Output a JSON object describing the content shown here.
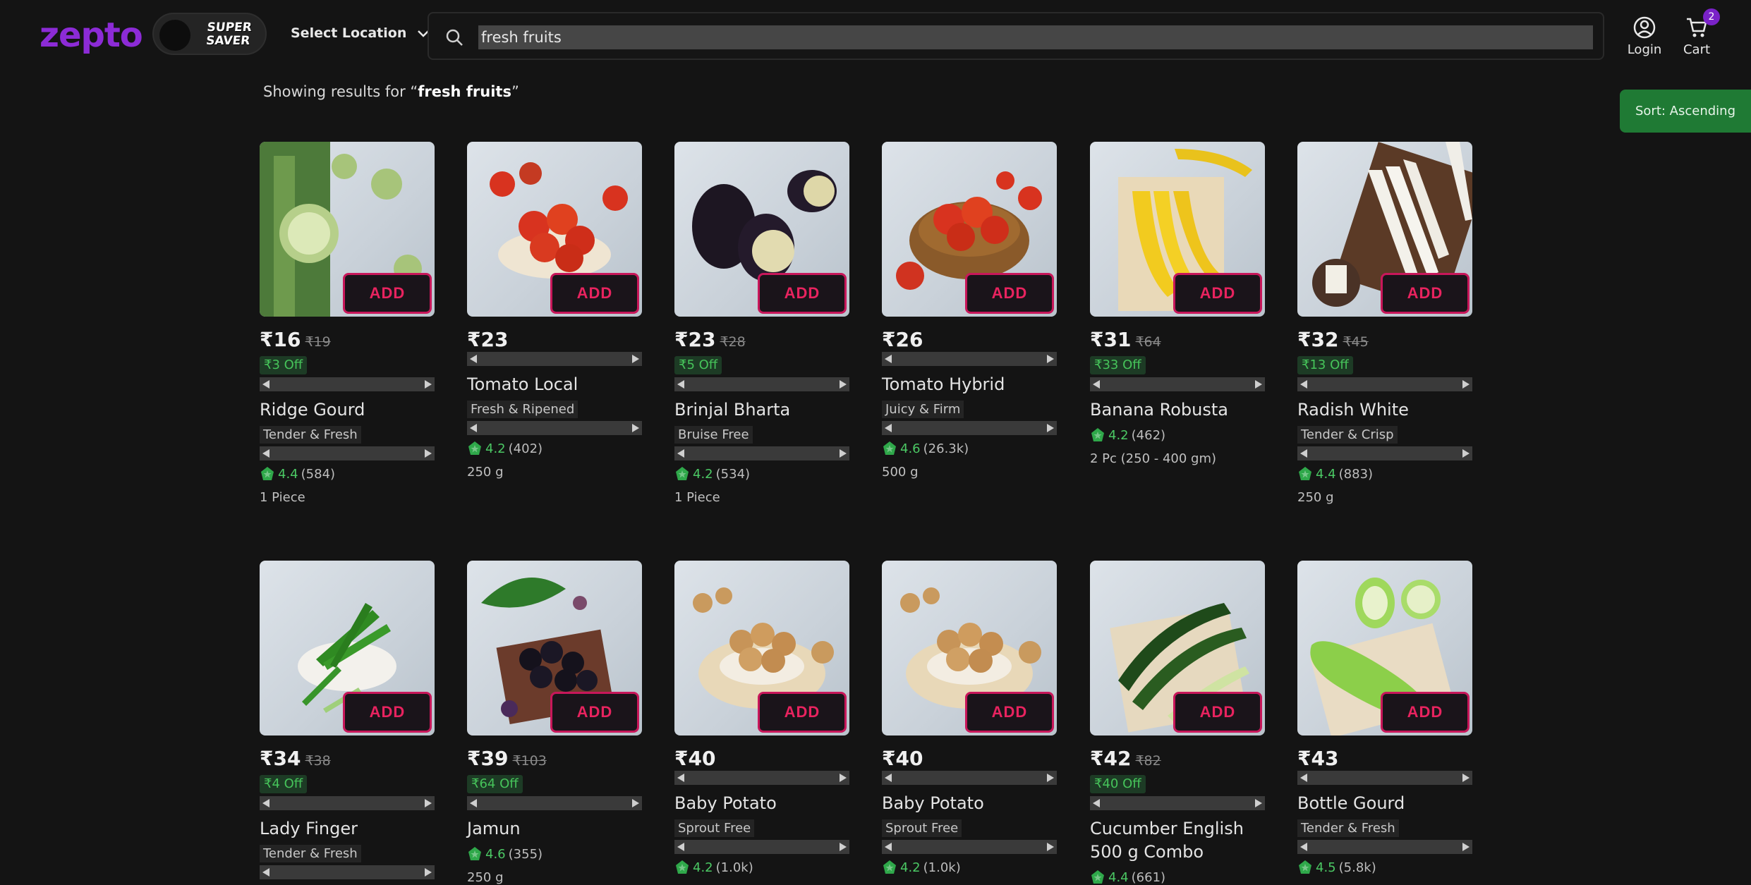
{
  "header": {
    "logo": "zepto",
    "super_saver_line1": "SUPER",
    "super_saver_line2": "SAVER",
    "location_label": "Select Location",
    "search_value": "fresh fruits",
    "login_label": "Login",
    "cart_label": "Cart",
    "cart_count": "2"
  },
  "results": {
    "prefix": "Showing results for “",
    "query": "fresh fruits",
    "suffix": "”"
  },
  "sort_label": "Sort: Ascending",
  "add_label": "ADD",
  "products": [
    {
      "price": "₹16",
      "old_price": "₹19",
      "off": "₹3 Off",
      "name": "Ridge Gourd",
      "tag": "Tender & Fresh",
      "rating": "4.4",
      "count": "(584)",
      "qty": "1 Piece",
      "pic": "ridge-gourd"
    },
    {
      "price": "₹23",
      "old_price": "",
      "off": "",
      "name": "Tomato Local",
      "tag": "Fresh & Ripened",
      "rating": "4.2",
      "count": "(402)",
      "qty": "250 g",
      "pic": "tomato"
    },
    {
      "price": "₹23",
      "old_price": "₹28",
      "off": "₹5 Off",
      "name": "Brinjal Bharta",
      "tag": "Bruise Free",
      "rating": "4.2",
      "count": "(534)",
      "qty": "1 Piece",
      "pic": "brinjal"
    },
    {
      "price": "₹26",
      "old_price": "",
      "off": "",
      "name": "Tomato Hybrid",
      "tag": "Juicy & Firm",
      "rating": "4.6",
      "count": "(26.3k)",
      "qty": "500 g",
      "pic": "tomato-basket"
    },
    {
      "price": "₹31",
      "old_price": "₹64",
      "off": "₹33 Off",
      "name": "Banana Robusta",
      "tag": "",
      "rating": "4.2",
      "count": "(462)",
      "qty": "2 Pc (250 - 400 gm)",
      "pic": "banana"
    },
    {
      "price": "₹32",
      "old_price": "₹45",
      "off": "₹13 Off",
      "name": "Radish White",
      "tag": "Tender & Crisp",
      "rating": "4.4",
      "count": "(883)",
      "qty": "250 g",
      "pic": "radish"
    },
    {
      "price": "₹34",
      "old_price": "₹38",
      "off": "₹4 Off",
      "name": "Lady Finger",
      "tag": "Tender & Fresh",
      "rating": "",
      "count": "",
      "qty": "",
      "pic": "okra"
    },
    {
      "price": "₹39",
      "old_price": "₹103",
      "off": "₹64 Off",
      "name": "Jamun",
      "tag": "",
      "rating": "4.6",
      "count": "(355)",
      "qty": "250 g",
      "pic": "jamun"
    },
    {
      "price": "₹40",
      "old_price": "",
      "off": "",
      "name": "Baby Potato",
      "tag": "Sprout Free",
      "rating": "4.2",
      "count": "(1.0k)",
      "qty": "",
      "pic": "potato"
    },
    {
      "price": "₹40",
      "old_price": "",
      "off": "",
      "name": "Baby Potato",
      "tag": "Sprout Free",
      "rating": "4.2",
      "count": "(1.0k)",
      "qty": "",
      "pic": "potato"
    },
    {
      "price": "₹42",
      "old_price": "₹82",
      "off": "₹40 Off",
      "name": "Cucumber English 500 g Combo",
      "tag": "",
      "rating": "4.4",
      "count": "(661)",
      "qty": "",
      "pic": "cucumber"
    },
    {
      "price": "₹43",
      "old_price": "",
      "off": "",
      "name": "Bottle Gourd",
      "tag": "Tender & Fresh",
      "rating": "4.5",
      "count": "(5.8k)",
      "qty": "",
      "pic": "bottle-gourd"
    }
  ]
}
